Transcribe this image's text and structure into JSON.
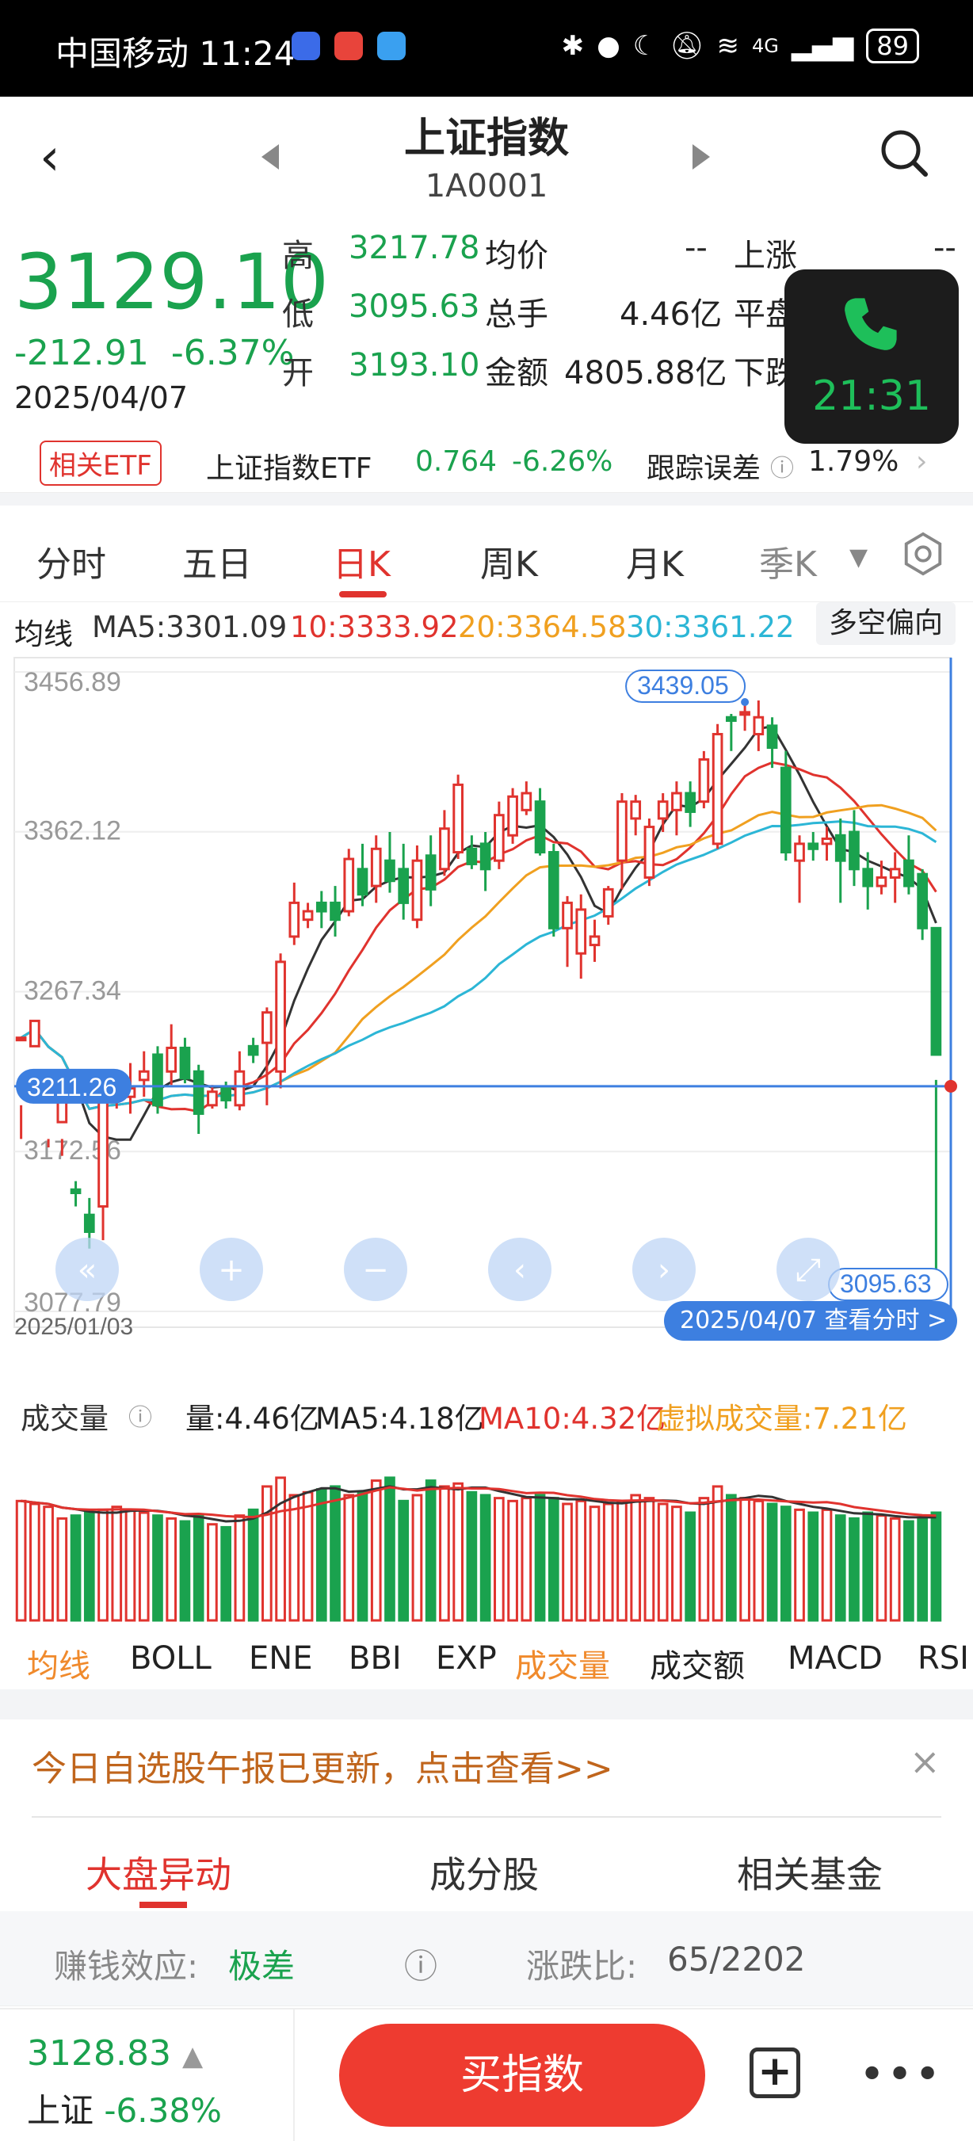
{
  "status": {
    "carrier_time": "中国移动 11:24",
    "battery": "89",
    "signal": "4G"
  },
  "header": {
    "title": "上证指数",
    "code": "1A0001"
  },
  "quote": {
    "price": "3129.10",
    "change": "-212.91",
    "pct": "-6.37%",
    "date": "2025/04/07",
    "high_label": "高",
    "high": "3217.78",
    "low_label": "低",
    "low": "3095.63",
    "open_label": "开",
    "open": "3193.10",
    "avg_label": "均价",
    "avg": "--",
    "vol_label": "总手",
    "vol": "4.46亿",
    "amt_label": "金额",
    "amt": "4805.88亿",
    "up_label": "上涨",
    "up": "--",
    "flat_label": "平盘",
    "down_label": "下跌"
  },
  "call": {
    "time": "21:31"
  },
  "etf": {
    "button": "相关ETF",
    "name": "上证指数ETF",
    "price": "0.764",
    "pct": "-6.26%",
    "track_label": "跟踪误差",
    "track": "1.79%"
  },
  "tabs": [
    "分时",
    "五日",
    "日K",
    "周K",
    "月K",
    "季K"
  ],
  "ma": {
    "label": "均线",
    "ma5": "MA5:3301.09",
    "ma10": "10:3333.92",
    "ma20": "20:3364.58",
    "ma30": "30:3361.22",
    "bias": "多空偏向"
  },
  "chart": {
    "y_ticks": [
      "3456.89",
      "3362.12",
      "3267.34",
      "3172.56",
      "3077.79"
    ],
    "cross_price": "3211.26",
    "high_tag": "3439.05",
    "low_tag": "3095.63",
    "start_date": "2025/01/03",
    "end_tag": "2025/04/07 查看分时 >"
  },
  "volume": {
    "label": "成交量",
    "v": "量:4.46亿",
    "ma5": "MA5:4.18亿",
    "ma10": "MA10:4.32亿",
    "virtual": "虚拟成交量:7.21亿"
  },
  "indicators": [
    "均线",
    "BOLL",
    "ENE",
    "BBI",
    "EXP",
    "成交量",
    "成交额",
    "MACD",
    "RSI"
  ],
  "notice": {
    "text": "今日自选股午报已更新，点击查看>>",
    "close": "×"
  },
  "subtabs": [
    "大盘异动",
    "成分股",
    "相关基金"
  ],
  "info": {
    "earn_label": "赚钱效应:",
    "earn": "极差",
    "ratio_label": "涨跌比:",
    "ratio": "65/2202"
  },
  "bottom": {
    "price": "3128.83",
    "name": "上证",
    "pct": "-6.38%",
    "buy": "买指数"
  },
  "colors": {
    "up": "#e0332e",
    "down": "#1aa24e",
    "ma5": "#333333",
    "ma10": "#e0332e",
    "ma20": "#f0a020",
    "ma30": "#2cb6d6"
  },
  "chart_data": {
    "type": "candlestick",
    "ylim": [
      3077.79,
      3456.89
    ],
    "candles": [
      [
        3240,
        3240,
        3200,
        3180
      ],
      [
        3235,
        3250,
        3215,
        3205
      ],
      [
        3205,
        3214,
        3180,
        3175
      ],
      [
        3190,
        3210,
        3180,
        3170
      ],
      [
        3150,
        3148,
        3155,
        3140
      ],
      [
        3135,
        3125,
        3145,
        3115
      ],
      [
        3140,
        3210,
        3215,
        3120
      ],
      [
        3205,
        3205,
        3215,
        3198
      ],
      [
        3205,
        3210,
        3225,
        3195
      ],
      [
        3215,
        3220,
        3232,
        3205
      ],
      [
        3230,
        3200,
        3235,
        3195
      ],
      [
        3220,
        3234,
        3248,
        3212
      ],
      [
        3234,
        3216,
        3240,
        3213
      ],
      [
        3220,
        3195,
        3224,
        3183
      ],
      [
        3200,
        3208,
        3212,
        3198
      ],
      [
        3210,
        3203,
        3214,
        3198
      ],
      [
        3200,
        3220,
        3232,
        3197
      ],
      [
        3235,
        3230,
        3240,
        3225
      ],
      [
        3237,
        3255,
        3258,
        3200
      ],
      [
        3220,
        3285,
        3290,
        3210
      ],
      [
        3300,
        3320,
        3332,
        3295
      ],
      [
        3310,
        3315,
        3320,
        3305
      ],
      [
        3320,
        3315,
        3327,
        3305
      ],
      [
        3320,
        3310,
        3330,
        3300
      ],
      [
        3315,
        3346,
        3352,
        3312
      ],
      [
        3340,
        3325,
        3355,
        3318
      ],
      [
        3330,
        3352,
        3360,
        3320
      ],
      [
        3345,
        3333,
        3362,
        3326
      ],
      [
        3340,
        3320,
        3355,
        3310
      ],
      [
        3310,
        3345,
        3354,
        3305
      ],
      [
        3348,
        3328,
        3360,
        3318
      ],
      [
        3340,
        3364,
        3375,
        3336
      ],
      [
        3350,
        3390,
        3396,
        3346
      ],
      [
        3352,
        3343,
        3360,
        3340
      ],
      [
        3355,
        3340,
        3362,
        3327
      ],
      [
        3345,
        3372,
        3380,
        3340
      ],
      [
        3360,
        3383,
        3388,
        3355
      ],
      [
        3375,
        3385,
        3392,
        3372
      ],
      [
        3380,
        3350,
        3388,
        3348
      ],
      [
        3350,
        3305,
        3355,
        3300
      ],
      [
        3305,
        3320,
        3324,
        3282
      ],
      [
        3290,
        3316,
        3325,
        3275
      ],
      [
        3295,
        3300,
        3310,
        3285
      ],
      [
        3312,
        3328,
        3330,
        3307
      ],
      [
        3345,
        3380,
        3385,
        3328
      ],
      [
        3370,
        3380,
        3384,
        3360
      ],
      [
        3335,
        3365,
        3370,
        3330
      ],
      [
        3370,
        3380,
        3385,
        3362
      ],
      [
        3375,
        3385,
        3392,
        3360
      ],
      [
        3385,
        3374,
        3392,
        3365
      ],
      [
        3380,
        3405,
        3410,
        3376
      ],
      [
        3355,
        3420,
        3426,
        3352
      ],
      [
        3430,
        3428,
        3432,
        3410
      ],
      [
        3433,
        3433,
        3439,
        3422
      ],
      [
        3420,
        3430,
        3440,
        3410
      ],
      [
        3425,
        3412,
        3430,
        3400
      ],
      [
        3400,
        3350,
        3410,
        3345
      ],
      [
        3345,
        3355,
        3360,
        3320
      ],
      [
        3355,
        3352,
        3362,
        3345
      ],
      [
        3355,
        3358,
        3365,
        3345
      ],
      [
        3360,
        3345,
        3370,
        3320
      ],
      [
        3362,
        3340,
        3375,
        3330
      ],
      [
        3340,
        3330,
        3350,
        3316
      ],
      [
        3330,
        3335,
        3345,
        3325
      ],
      [
        3335,
        3340,
        3350,
        3320
      ],
      [
        3345,
        3330,
        3360,
        3325
      ],
      [
        3337,
        3305,
        3340,
        3298
      ],
      [
        3305,
        3230,
        3215,
        3095
      ]
    ]
  }
}
